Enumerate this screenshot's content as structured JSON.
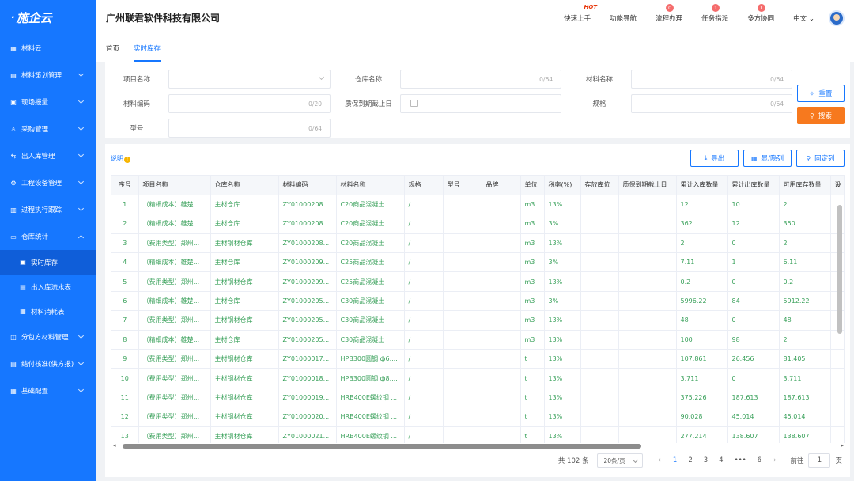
{
  "app": {
    "logo": "施企云",
    "company": "广州联君软件科技有限公司"
  },
  "topnav": {
    "items": [
      {
        "label": "快速上手",
        "hot": "HOT"
      },
      {
        "label": "功能导航"
      },
      {
        "label": "流程办理",
        "badge": "0"
      },
      {
        "label": "任务指派",
        "badge": "1"
      },
      {
        "label": "多方协同",
        "badge": "1"
      }
    ],
    "lang": "中文"
  },
  "sidebar": {
    "items": [
      {
        "label": "材料云",
        "icon": "grid-icon"
      },
      {
        "label": "材料策划管理",
        "icon": "plan-icon"
      },
      {
        "label": "现场报量",
        "icon": "report-icon"
      },
      {
        "label": "采购管理",
        "icon": "purchase-icon"
      },
      {
        "label": "出入库管理",
        "icon": "inout-icon"
      },
      {
        "label": "工程设备管理",
        "icon": "equipment-icon"
      },
      {
        "label": "过程执行跟踪",
        "icon": "track-icon"
      },
      {
        "label": "仓库统计",
        "icon": "warehouse-icon"
      },
      {
        "label": "实时库存",
        "icon": "stock-icon"
      },
      {
        "label": "出入库流水表",
        "icon": "flow-icon"
      },
      {
        "label": "材料消耗表",
        "icon": "consume-icon"
      },
      {
        "label": "分包方材料管理",
        "icon": "subcontract-icon"
      },
      {
        "label": "结付核准(供方报)",
        "icon": "settle-icon"
      },
      {
        "label": "基础配置",
        "icon": "config-icon"
      }
    ]
  },
  "tabs": [
    "首页",
    "实时库存"
  ],
  "filter": {
    "project": {
      "label": "项目名称",
      "value": ""
    },
    "warehouse": {
      "label": "仓库名称",
      "count": "0/64"
    },
    "material_name": {
      "label": "材料名称",
      "count": "0/64"
    },
    "material_code": {
      "label": "材料编码",
      "count": "0/20"
    },
    "expiry": {
      "label": "质保到期截止日"
    },
    "spec": {
      "label": "规格",
      "count": "0/64"
    },
    "model": {
      "label": "型号",
      "count": "0/64"
    },
    "reset": "重置",
    "search": "搜索"
  },
  "toolbar": {
    "explain": "说明",
    "export": "导出",
    "toggle": "显/隐列",
    "fix": "固定列"
  },
  "table": {
    "headers": [
      "序号",
      "项目名称",
      "仓库名称",
      "材料编码",
      "材料名称",
      "规格",
      "型号",
      "品牌",
      "单位",
      "税率(%)",
      "存放库位",
      "质保到期截止日",
      "累计入库数量",
      "累计出库数量",
      "可用库存数量",
      "设"
    ],
    "rows": [
      [
        "1",
        "（精细成本）雄楚...",
        "主材仓库",
        "ZY01000208...",
        "C20商品混凝土",
        "/",
        "",
        "",
        "m3",
        "13%",
        "",
        "",
        "12",
        "10",
        "2"
      ],
      [
        "2",
        "（精细成本）雄楚...",
        "主材仓库",
        "ZY01000208...",
        "C20商品混凝土",
        "/",
        "",
        "",
        "m3",
        "3%",
        "",
        "",
        "362",
        "12",
        "350"
      ],
      [
        "3",
        "（费用类型）郑州...",
        "主材钢材仓库",
        "ZY01000208...",
        "C20商品混凝土",
        "/",
        "",
        "",
        "m3",
        "13%",
        "",
        "",
        "2",
        "0",
        "2"
      ],
      [
        "4",
        "（精细成本）雄楚...",
        "主材仓库",
        "ZY01000209...",
        "C25商品混凝土",
        "/",
        "",
        "",
        "m3",
        "3%",
        "",
        "",
        "7.11",
        "1",
        "6.11"
      ],
      [
        "5",
        "（费用类型）郑州...",
        "主材钢材仓库",
        "ZY01000209...",
        "C25商品混凝土",
        "/",
        "",
        "",
        "m3",
        "13%",
        "",
        "",
        "0.2",
        "0",
        "0.2"
      ],
      [
        "6",
        "（精细成本）雄楚...",
        "主材仓库",
        "ZY01000205...",
        "C30商品混凝土",
        "/",
        "",
        "",
        "m3",
        "3%",
        "",
        "",
        "5996.22",
        "84",
        "5912.22"
      ],
      [
        "7",
        "（费用类型）郑州...",
        "主材钢材仓库",
        "ZY01000205...",
        "C30商品混凝土",
        "/",
        "",
        "",
        "m3",
        "13%",
        "",
        "",
        "48",
        "0",
        "48"
      ],
      [
        "8",
        "（精细成本）雄楚...",
        "主材仓库",
        "ZY01000205...",
        "C30商品混凝土",
        "/",
        "",
        "",
        "m3",
        "13%",
        "",
        "",
        "100",
        "98",
        "2"
      ],
      [
        "9",
        "（费用类型）郑州...",
        "主材钢材仓库",
        "ZY01000017...",
        "HPB300圆钢 ф6....",
        "/",
        "",
        "",
        "t",
        "13%",
        "",
        "",
        "107.861",
        "26.456",
        "81.405"
      ],
      [
        "10",
        "（费用类型）郑州...",
        "主材钢材仓库",
        "ZY01000018...",
        "HPB300圆钢 ф8....",
        "/",
        "",
        "",
        "t",
        "13%",
        "",
        "",
        "3.711",
        "0",
        "3.711"
      ],
      [
        "11",
        "（费用类型）郑州...",
        "主材钢材仓库",
        "ZY01000019...",
        "HRB400E螺纹钢 ...",
        "/",
        "",
        "",
        "t",
        "13%",
        "",
        "",
        "375.226",
        "187.613",
        "187.613"
      ],
      [
        "12",
        "（费用类型）郑州...",
        "主材钢材仓库",
        "ZY01000020...",
        "HRB400E螺纹钢 ...",
        "/",
        "",
        "",
        "t",
        "13%",
        "",
        "",
        "90.028",
        "45.014",
        "45.014"
      ],
      [
        "13",
        "（费用类型）郑州...",
        "主材钢材仓库",
        "ZY01000021...",
        "HRB400E螺纹钢 ...",
        "/",
        "",
        "",
        "t",
        "13%",
        "",
        "",
        "277.214",
        "138.607",
        "138.607"
      ]
    ]
  },
  "pagination": {
    "total": "共 102 条",
    "page_size": "20条/页",
    "pages": [
      "1",
      "2",
      "3",
      "4",
      "•••",
      "6"
    ],
    "current": "1",
    "goto_label": "前往",
    "goto_value": "1",
    "goto_suffix": "页"
  },
  "colors": {
    "primary": "#1677ff",
    "orange": "#f7791e",
    "green_text": "#3aa15b"
  }
}
